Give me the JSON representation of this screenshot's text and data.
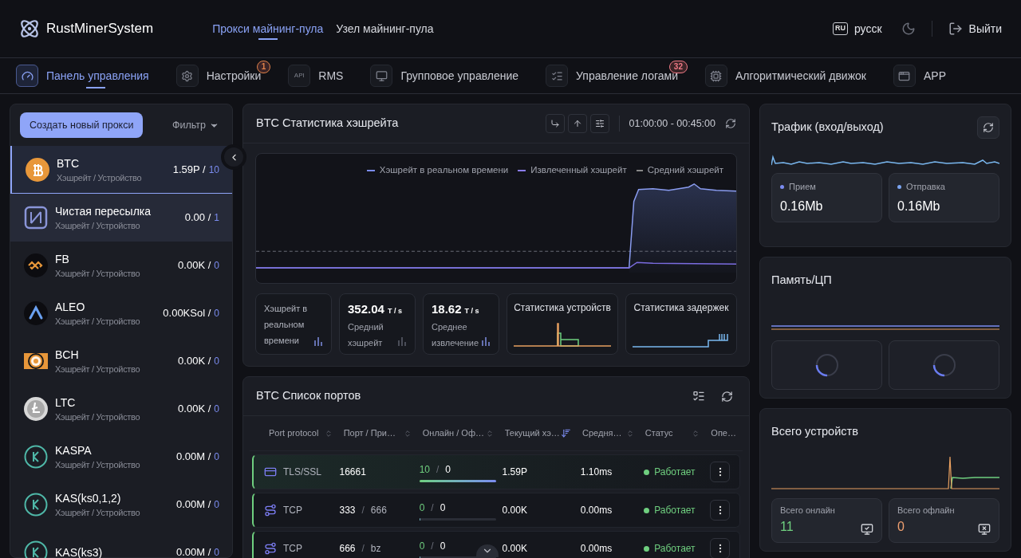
{
  "brand": "RustMinerSystem",
  "top_tabs": [
    {
      "label": "Прокси майнинг-пула",
      "selected": true
    },
    {
      "label": "Узел майнинг-пула",
      "selected": false
    }
  ],
  "language": {
    "code": "RU",
    "label": "русск"
  },
  "logout": "Выйти",
  "nav": [
    {
      "label": "Панель управления",
      "selected": true
    },
    {
      "label": "Настройки",
      "selected": false,
      "badge": "1",
      "color": "#e0824a"
    },
    {
      "label": "RMS",
      "selected": false,
      "icon_text": "API"
    },
    {
      "label": "Групповое управление",
      "selected": false
    },
    {
      "label": "Управление логами",
      "selected": false,
      "badge": "32",
      "color": "#f07a86"
    },
    {
      "label": "Алгоритмический движок",
      "selected": false
    },
    {
      "label": "APP",
      "selected": false
    }
  ],
  "sidebar": {
    "create_button": "Создать новый прокси",
    "filter": "Фильтр",
    "items": [
      {
        "name": "BTC",
        "subtitle": "Хэшрейт / Устройство",
        "hashrate": "1.59P /",
        "devices": "10",
        "selected": true,
        "hovered": false
      },
      {
        "name": "Чистая пересылка",
        "subtitle": "Хэшрейт / Устройство",
        "hashrate": "0.00 /",
        "devices": "1",
        "selected": false,
        "hovered": true
      },
      {
        "name": "FB",
        "subtitle": "Хэшрейт / Устройство",
        "hashrate": "0.00K /",
        "devices": "0",
        "selected": false,
        "hovered": false
      },
      {
        "name": "ALEO",
        "subtitle": "Хэшрейт / Устройство",
        "hashrate": "0.00KSol /",
        "devices": "0",
        "selected": false,
        "hovered": false
      },
      {
        "name": "BCH",
        "subtitle": "Хэшрейт / Устройство",
        "hashrate": "0.00K /",
        "devices": "0",
        "selected": false,
        "hovered": false
      },
      {
        "name": "LTC",
        "subtitle": "Хэшрейт / Устройство",
        "hashrate": "0.00K /",
        "devices": "0",
        "selected": false,
        "hovered": false
      },
      {
        "name": "KASPA",
        "subtitle": "Хэшрейт / Устройство",
        "hashrate": "0.00M /",
        "devices": "0",
        "selected": false,
        "hovered": false
      },
      {
        "name": "KAS(ks0,1,2)",
        "subtitle": "Хэшрейт / Устройство",
        "hashrate": "0.00M /",
        "devices": "0",
        "selected": false,
        "hovered": false
      },
      {
        "name": "KAS(ks3)",
        "hashrate": "0.00M /",
        "devices": "0",
        "selected": false,
        "hovered": false
      }
    ]
  },
  "hashrate_panel": {
    "title": "BTC Статистика хэшрейта",
    "time_range": "01:00:00 - 00:45:00",
    "legend": [
      {
        "label": "Хэшрейт в реальном времени",
        "kind": "solid",
        "color": "#7b8cf0"
      },
      {
        "label": "Извлеченный хэшрейт",
        "kind": "solid",
        "color": "#8b7cf0"
      },
      {
        "label": "Средний хэшрейт",
        "kind": "dashed",
        "color": "#888888"
      }
    ],
    "stats": [
      {
        "kind": "label",
        "label": "Хэшрейт в реальном времени"
      },
      {
        "kind": "value",
        "value": "352.04",
        "unit": "T / s",
        "label": "Средний хэшрейт"
      },
      {
        "kind": "value",
        "value": "18.62",
        "unit": "T / s",
        "label": "Среднее извлечение"
      },
      {
        "kind": "devices",
        "label": "Статистика устройств"
      },
      {
        "kind": "latency",
        "label": "Статистика задержек"
      }
    ]
  },
  "ports_panel": {
    "title": "BTC Список портов",
    "columns": [
      {
        "label": "Port protocol",
        "sorted": false
      },
      {
        "label": "Порт / При…",
        "sorted": false
      },
      {
        "label": "Онлайн / Оф…",
        "sorted": false
      },
      {
        "label": "Текущий хэ…",
        "sorted": true
      },
      {
        "label": "Средня…",
        "sorted": false
      },
      {
        "label": "Статус",
        "sorted": false
      },
      {
        "label": "Опе…"
      }
    ],
    "rows": [
      {
        "kind": "tls",
        "protocol": "TLS/SSL",
        "port": "16661",
        "online": "10",
        "separator": "/",
        "offline": "0",
        "level": 1,
        "hashrate": "1.59P",
        "latency": "1.10ms",
        "status": "Работает",
        "selected": true
      },
      {
        "kind": "tcp",
        "protocol": "TCP",
        "port": "333",
        "port_separator": "/",
        "port_2": "666",
        "online": "0",
        "separator": "/",
        "offline": "0",
        "level": 0,
        "hashrate": "0.00K",
        "latency": "0.00ms",
        "status": "Работает",
        "selected": false
      },
      {
        "kind": "tcp",
        "protocol": "TCP",
        "port": "666",
        "port_separator": "/",
        "port_2": "bz",
        "online": "0",
        "separator": "/",
        "offline": "0",
        "level": 0,
        "hashrate": "0.00K",
        "latency": "0.00ms",
        "status": "Работает",
        "selected": false
      }
    ]
  },
  "traffic": {
    "title": "Трафик (вход/выход)",
    "cards": [
      {
        "label": "Прием",
        "value": "0.16Mb",
        "color": "#7b8cf0"
      },
      {
        "label": "Отправка",
        "value": "0.16Mb",
        "color": "#7ba4f0"
      }
    ]
  },
  "memory": {
    "title": "Память/ЦП"
  },
  "devices": {
    "title": "Всего устройств",
    "cards": [
      {
        "kind": "online",
        "label": "Всего онлайн",
        "value": "11",
        "color": "#6fcf7f"
      },
      {
        "kind": "offline",
        "label": "Всего офлайн",
        "value": "0",
        "color": "#f0a070"
      }
    ]
  }
}
